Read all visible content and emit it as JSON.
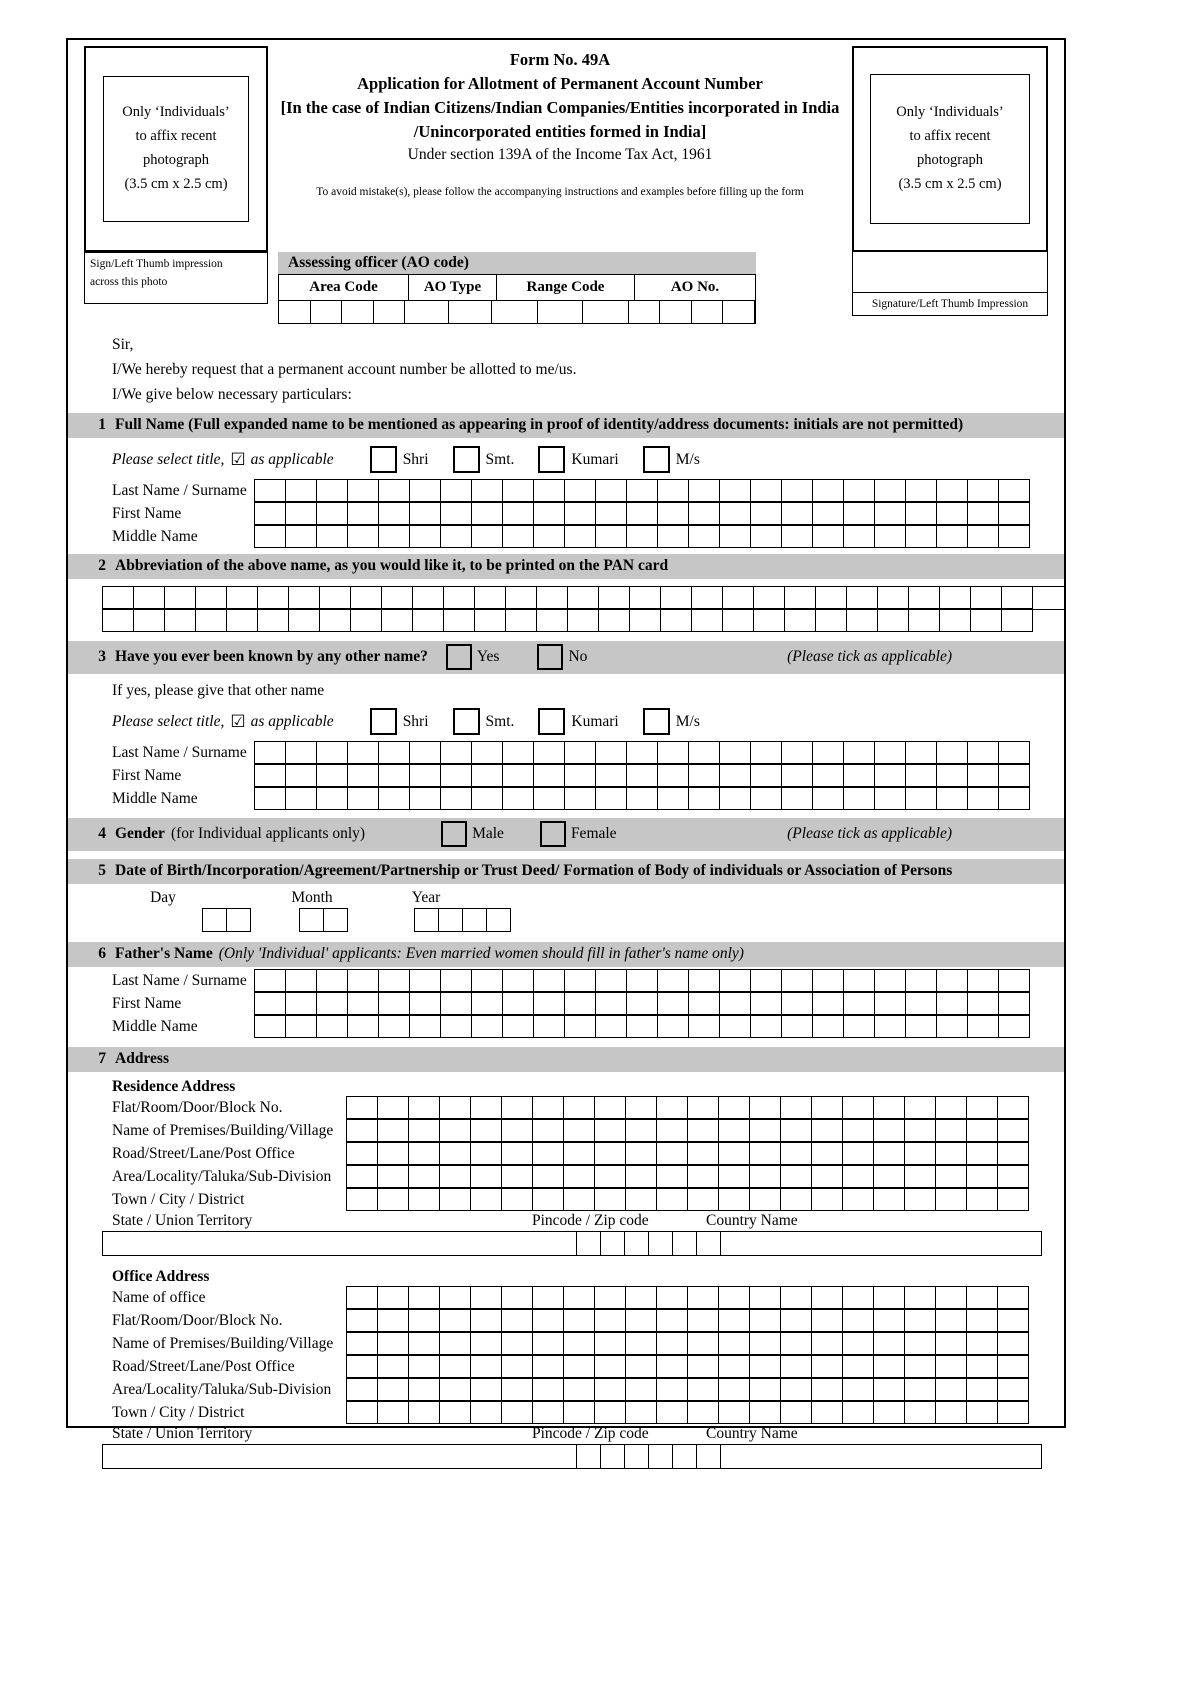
{
  "header": {
    "photo_left": [
      "Only ‘Individuals’",
      "to affix recent",
      "photograph",
      "(3.5 cm x 2.5 cm)"
    ],
    "photo_right": [
      "Only ‘Individuals’",
      "to affix recent",
      "photograph",
      "(3.5 cm x 2.5 cm)"
    ],
    "form_no": "Form No. 49A",
    "title": "Application for Allotment of Permanent Account Number",
    "bracket_line1": "[In the case of Indian Citizens/Indian Companies/Entities incorporated in India",
    "bracket_line2": "/Unincorporated entities formed in India]",
    "section_ref": "Under section 139A of the Income Tax Act, 1961",
    "note": "To avoid mistake(s), please follow the accompanying instructions and examples before filling up the form",
    "sign_left_line1": "Sign/Left Thumb impression",
    "sign_left_line2": "across this photo",
    "sign_right": "Signature/Left Thumb Impression"
  },
  "ao": {
    "title": "Assessing officer (AO code)",
    "columns": [
      "Area Code",
      "AO Type",
      "Range Code",
      "AO No."
    ],
    "cell_counts": [
      4,
      2,
      3,
      5
    ]
  },
  "salutation": {
    "line1": "Sir,",
    "line2": "I/We hereby request that a permanent account number be allotted to me/us.",
    "line3": "I/We give below necessary particulars:"
  },
  "titles": {
    "prompt_pre": "Please select title,",
    "checkbox_glyph": "☑",
    "prompt_post": "as applicable",
    "options": [
      "Shri",
      "Smt.",
      "Kumari",
      "M/s"
    ]
  },
  "name_labels": [
    "Last Name / Surname",
    "First Name",
    "Middle Name"
  ],
  "sections": {
    "s1": {
      "num": "1",
      "label": "Full Name (Full expanded name to be mentioned as appearing in proof of identity/address documents: initials are not permitted)"
    },
    "s2": {
      "num": "2",
      "label": "Abbreviation of the above name, as you would like it, to be printed on the PAN card"
    },
    "s3": {
      "num": "3",
      "label": "Have you ever been known by any other name?",
      "yes": "Yes",
      "no": "No",
      "note": "(Please tick as applicable)",
      "subprompt": "If yes, please give that other name"
    },
    "s4": {
      "num": "4",
      "label_bold": "Gender",
      "label_rest": "(for Individual applicants only)",
      "male": "Male",
      "female": "Female",
      "note": "(Please tick as applicable)"
    },
    "s5": {
      "num": "5",
      "label": "Date of Birth/Incorporation/Agreement/Partnership or Trust Deed/ Formation of Body of individuals or Association of Persons",
      "day": "Day",
      "month": "Month",
      "year": "Year",
      "day_cells": 2,
      "month_cells": 2,
      "year_cells": 4
    },
    "s6": {
      "num": "6",
      "label_bold": "Father's Name",
      "label_rest": "(Only 'Individual' applicants: Even married women should fill in father's name only)"
    },
    "s7": {
      "num": "7",
      "label": "Address"
    }
  },
  "address": {
    "residence_heading": "Residence Address",
    "office_heading": "Office Address",
    "residence_rows": [
      "Flat/Room/Door/Block No.",
      "Name of Premises/Building/Village",
      "Road/Street/Lane/Post Office",
      "Area/Locality/Taluka/Sub-Division",
      "Town / City / District"
    ],
    "office_rows": [
      "Name of office",
      "Flat/Room/Door/Block No.",
      "Name of Premises/Building/Village",
      "Road/Street/Lane/Post Office",
      "Area/Locality/Taluka/Sub-Division",
      "Town / City / District"
    ],
    "state_label": "State / Union Territory",
    "pincode_label": "Pincode / Zip code",
    "country_label": "Country Name",
    "pincode_cells": 6
  },
  "grid_counts": {
    "name_cells": 25,
    "abbrev_cells": 30,
    "address_cells": 22
  },
  "colors": {
    "bar_bg": "#c6c6c6",
    "ink": "#000000",
    "paper": "#ffffff"
  }
}
